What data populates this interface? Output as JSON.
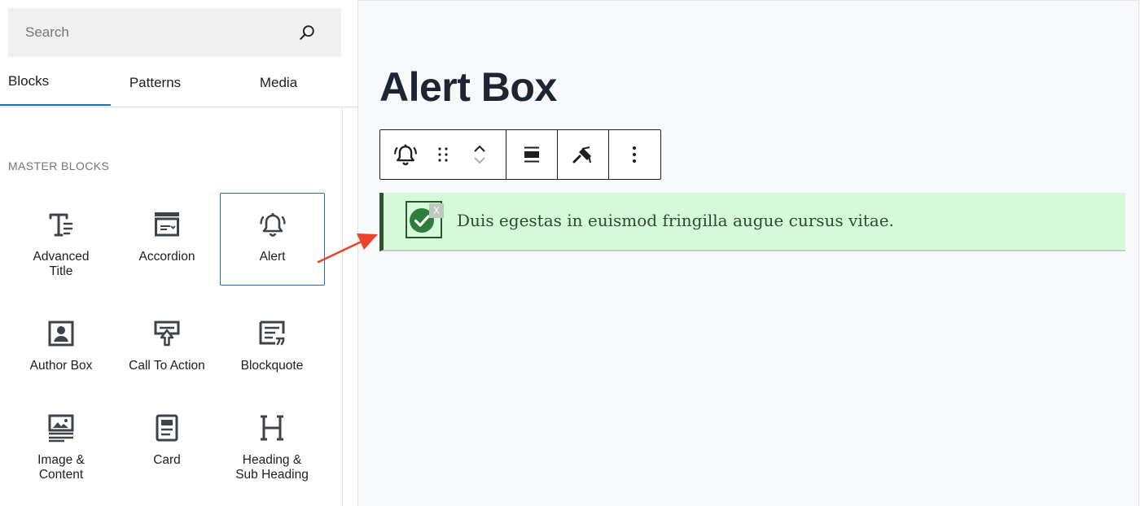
{
  "search": {
    "placeholder": "Search"
  },
  "tabs": [
    {
      "label": "Blocks",
      "active": true
    },
    {
      "label": "Patterns",
      "active": false
    },
    {
      "label": "Media",
      "active": false
    }
  ],
  "category": "MASTER BLOCKS",
  "blocks": [
    {
      "label": "Advanced\nTitle",
      "icon": "advanced-title-icon",
      "selected": false
    },
    {
      "label": "Accordion",
      "icon": "accordion-icon",
      "selected": false
    },
    {
      "label": "Alert",
      "icon": "bell-icon",
      "selected": true
    },
    {
      "label": "Author Box",
      "icon": "author-box-icon",
      "selected": false
    },
    {
      "label": "Call To Action",
      "icon": "call-to-action-icon",
      "selected": false
    },
    {
      "label": "Blockquote",
      "icon": "blockquote-icon",
      "selected": false
    },
    {
      "label": "Image &\nContent",
      "icon": "image-content-icon",
      "selected": false
    },
    {
      "label": "Card",
      "icon": "card-icon",
      "selected": false
    },
    {
      "label": "Heading &\nSub Heading",
      "icon": "heading-icon",
      "selected": false
    }
  ],
  "editor": {
    "page_title": "Alert Box",
    "toolbar": [
      "bell-icon",
      "drag-handle-icon",
      "move-up-down-icon",
      "align-icon",
      "style-brush-icon",
      "more-options-icon"
    ],
    "alert": {
      "text": "Duis egestas in euismod fringilla augue cursus vitae.",
      "close_label": "X",
      "icon": "check-circle-icon"
    }
  },
  "colors": {
    "accent": "#2271b1",
    "alert_bg": "#d5fad9",
    "alert_border": "#2a552d",
    "arrow": "#e8432b",
    "title": "#1d2535"
  }
}
